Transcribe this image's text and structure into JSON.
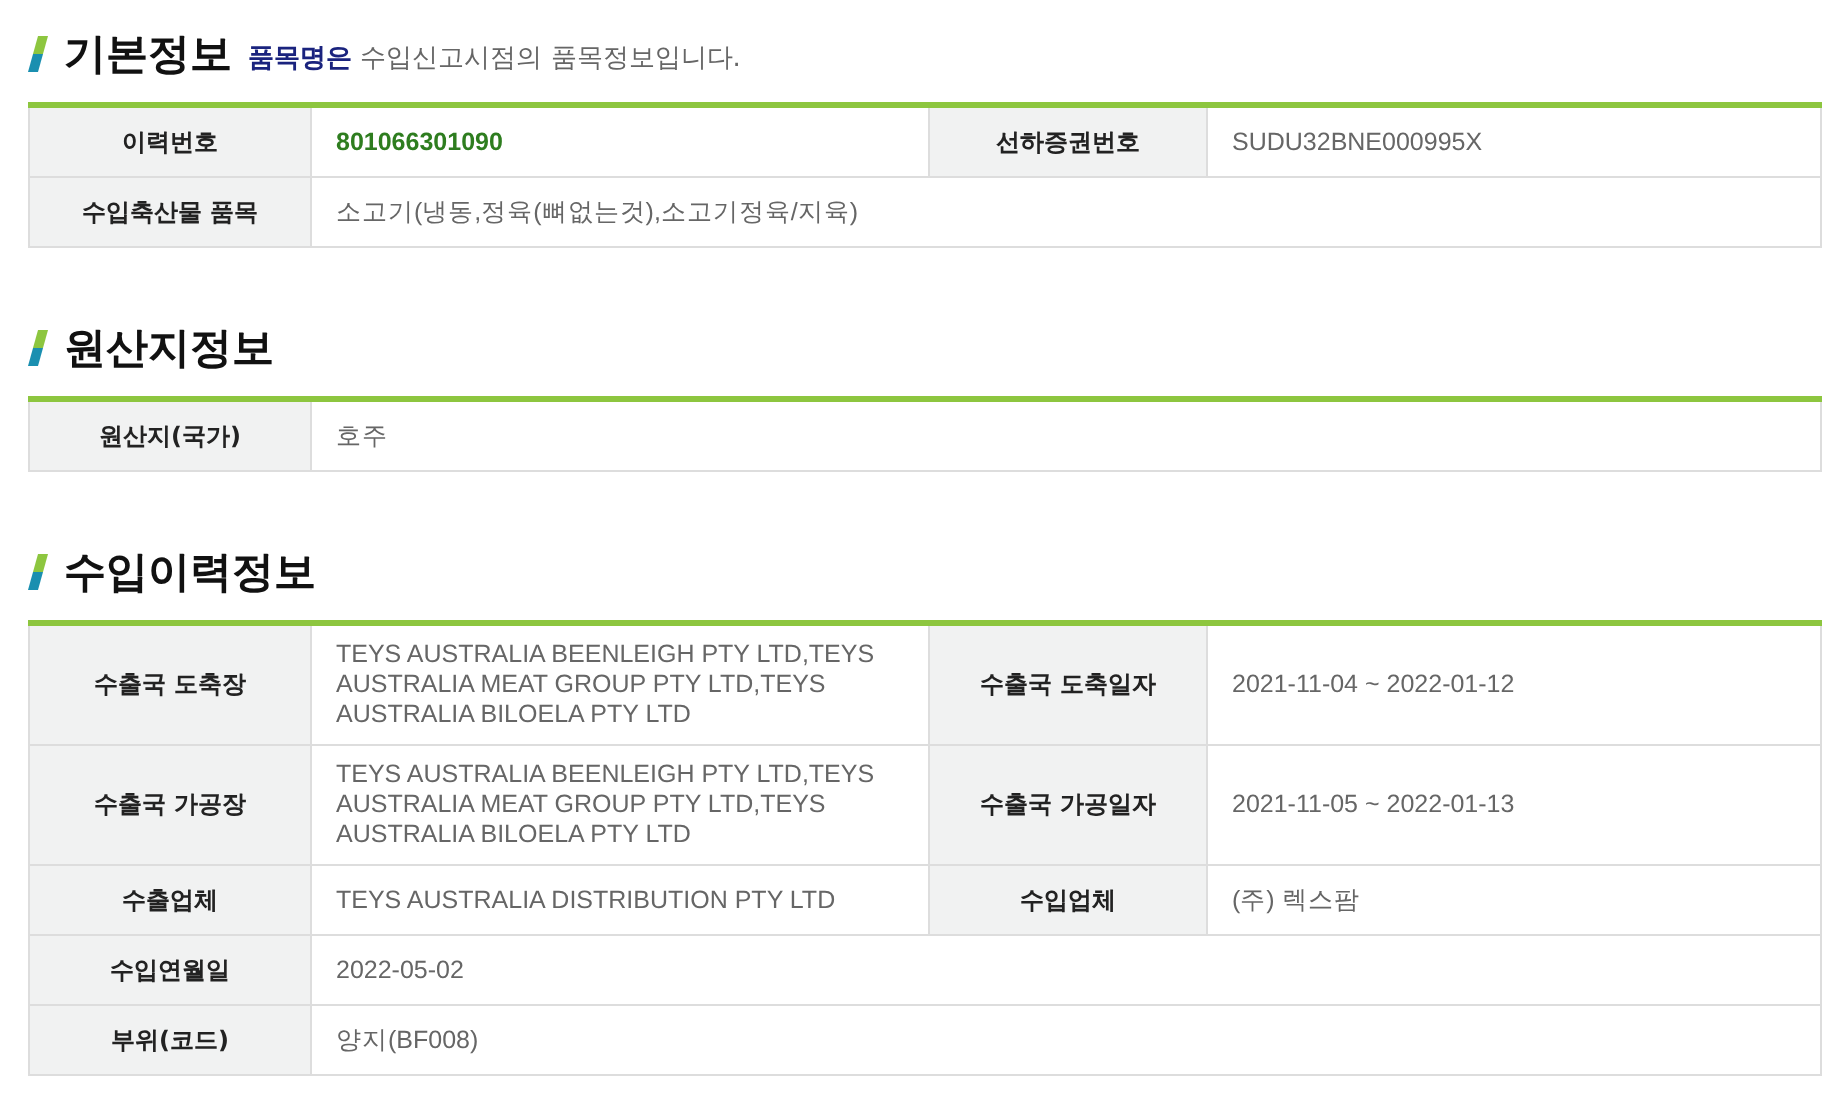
{
  "sections": [
    {
      "title": "기본정보",
      "subtitle": "**품목명은** 수입신고시점의 품목정보입니다.",
      "rows": [
        [
          {
            "label": "이력번호",
            "value": "801066301090",
            "highlight": true
          },
          {
            "label": "선하증권번호",
            "value": "SUDU32BNE000995X",
            "highlight": false
          }
        ],
        [
          {
            "label": "수입축산물 품목",
            "value": "소고기(냉동,정육(뼈없는것),소고기정육/지육)",
            "highlight": false
          }
        ]
      ]
    },
    {
      "title": "원산지정보",
      "rows": [
        [
          {
            "label": "원산지(국가)",
            "value": "호주",
            "highlight": false
          }
        ]
      ]
    },
    {
      "title": "수입이력정보",
      "rows": [
        [
          {
            "label": "수출국 도축장",
            "value": "TEYS AUSTRALIA BEENLEIGH PTY LTD,TEYS AUSTRALIA MEAT GROUP PTY LTD,TEYS AUSTRALIA BILOELA PTY LTD",
            "highlight": false
          },
          {
            "label": "수출국 도축일자",
            "value": "2021-11-04 ~ 2022-01-12",
            "highlight": false
          }
        ],
        [
          {
            "label": "수출국 가공장",
            "value": "TEYS AUSTRALIA BEENLEIGH PTY LTD,TEYS AUSTRALIA MEAT GROUP PTY LTD,TEYS AUSTRALIA BILOELA PTY LTD",
            "highlight": false
          },
          {
            "label": "수출국 가공일자",
            "value": "2021-11-05 ~ 2022-01-13",
            "highlight": false
          }
        ],
        [
          {
            "label": "수출업체",
            "value": "TEYS AUSTRALIA DISTRIBUTION PTY LTD",
            "highlight": false
          },
          {
            "label": "수입업체",
            "value": "(주) 렉스팜",
            "highlight": false
          }
        ],
        [
          {
            "label": "수입연월일",
            "value": "2022-05-02",
            "highlight": false
          }
        ],
        [
          {
            "label": "부위(코드)",
            "value": "양지(BF008)",
            "highlight": false
          }
        ]
      ]
    }
  ]
}
